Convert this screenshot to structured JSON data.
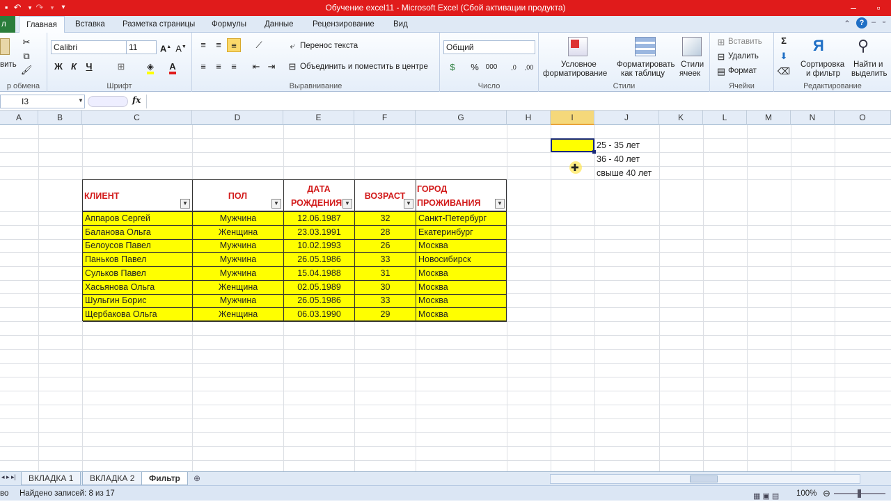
{
  "window": {
    "title": "Обучение excel11  -  Microsoft Excel (Сбой активации продукта)"
  },
  "tabs": [
    "л",
    "Главная",
    "Вставка",
    "Разметка страницы",
    "Формулы",
    "Данные",
    "Рецензирование",
    "Вид"
  ],
  "ribbon": {
    "clipboard": {
      "paste": "вить",
      "group": "р обмена"
    },
    "font": {
      "name": "Calibri",
      "size": "11",
      "group": "Шрифт"
    },
    "alignment": {
      "wrap": "Перенос текста",
      "merge": "Объединить и поместить в центре",
      "group": "Выравнивание"
    },
    "number": {
      "format": "Общий",
      "group": "Число"
    },
    "styles": {
      "cond1": "Условное",
      "cond2": "форматирование",
      "table1": "Форматировать",
      "table2": "как таблицу",
      "cell1": "Стили",
      "cell2": "ячеек",
      "group": "Стили"
    },
    "cells": {
      "insert": "Вставить",
      "delete": "Удалить",
      "format": "Формат",
      "group": "Ячейки"
    },
    "editing": {
      "sort1": "Сортировка",
      "sort2": "и фильтр",
      "find1": "Найти и",
      "find2": "выделить",
      "group": "Редактирование"
    }
  },
  "formula_bar": {
    "name_box": "I3",
    "fx": "fx",
    "value": ""
  },
  "columns": [
    "A",
    "B",
    "C",
    "D",
    "E",
    "F",
    "G",
    "H",
    "I",
    "J",
    "K",
    "L",
    "M",
    "N",
    "O"
  ],
  "legend": {
    "items": [
      "25 - 35 лет",
      "36 - 40 лет",
      "свыше 40 лет"
    ],
    "highlight_color": "#ffff00"
  },
  "table": {
    "headers": [
      [
        "КЛИЕНТ"
      ],
      [
        "ПОЛ"
      ],
      [
        "ДАТА",
        "РОЖДЕНИЯ"
      ],
      [
        "ВОЗРАСТ"
      ],
      [
        "ГОРОД",
        "ПРОЖИВАНИЯ"
      ]
    ],
    "rows": [
      [
        "Аппаров Сергей",
        "Мужчина",
        "12.06.1987",
        "32",
        "Санкт-Петербург"
      ],
      [
        "Баланова Ольга",
        "Женщина",
        "23.03.1991",
        "28",
        "Екатеринбург"
      ],
      [
        "Белоусов Павел",
        "Мужчина",
        "10.02.1993",
        "26",
        "Москва"
      ],
      [
        "Паньков Павел",
        "Мужчина",
        "26.05.1986",
        "33",
        "Новосибирск"
      ],
      [
        "Сульков Павел",
        "Мужчина",
        "15.04.1988",
        "31",
        "Москва"
      ],
      [
        "Хасьянова Ольга",
        "Женщина",
        "02.05.1989",
        "30",
        "Москва"
      ],
      [
        "Шульгин Борис",
        "Мужчина",
        "26.05.1986",
        "33",
        "Москва"
      ],
      [
        "Щербакова Ольга",
        "Женщина",
        "06.03.1990",
        "29",
        "Москва"
      ]
    ],
    "row_color": "#ffff00",
    "header_color": "#d21a1a"
  },
  "sheets": [
    "ВКЛАДКА 1",
    "ВКЛАДКА 2",
    "Фильтр"
  ],
  "status": {
    "mode": "во",
    "records": "Найдено записей: 8 из 17",
    "zoom": "100%"
  }
}
